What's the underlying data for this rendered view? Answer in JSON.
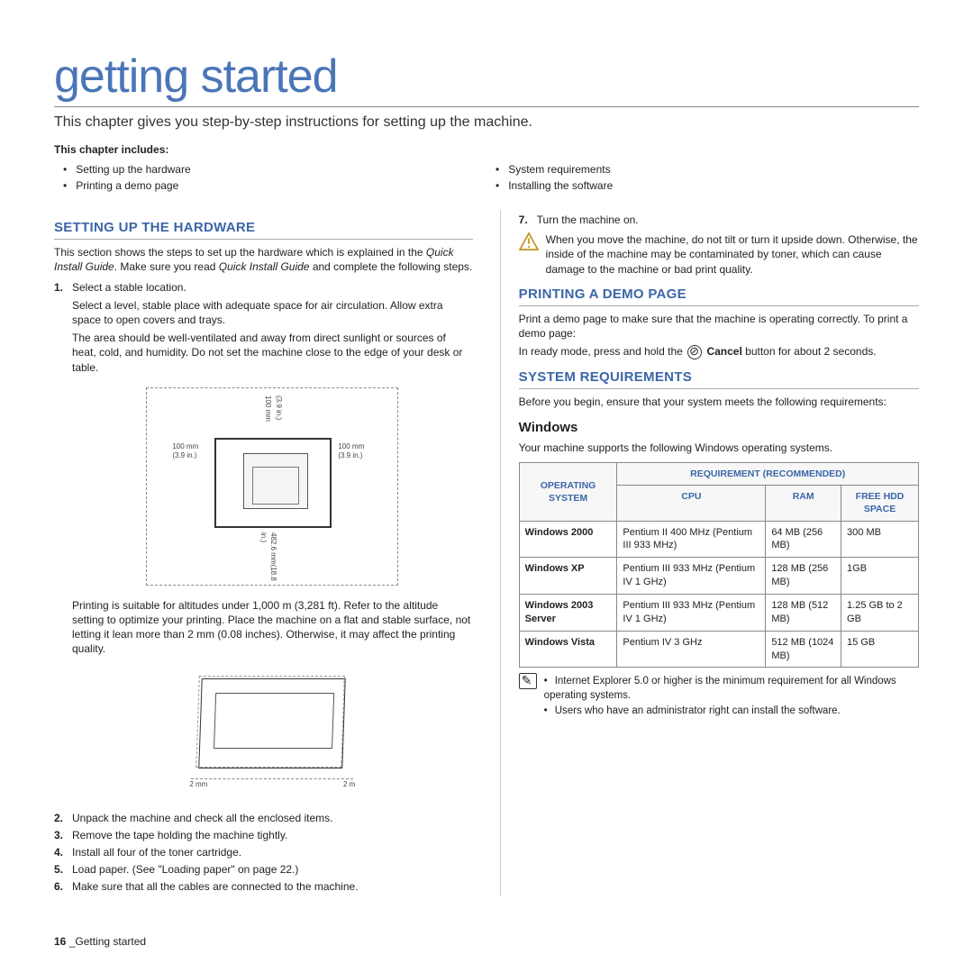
{
  "title": "getting started",
  "subtitle": "This chapter gives you step-by-step instructions for setting up the machine.",
  "includes_label": "This chapter includes:",
  "includes_left": [
    "Setting up the hardware",
    "Printing a demo page"
  ],
  "includes_right": [
    "System requirements",
    "Installing the software"
  ],
  "sec_hardware": {
    "heading": "SETTING UP THE HARDWARE",
    "intro_1": "This section shows the steps to set up the hardware which is explained in the ",
    "intro_em1": "Quick Install Guide",
    "intro_2": ". Make sure you read ",
    "intro_em2": "Quick Install Guide",
    "intro_3": " and complete the following steps.",
    "step1_head": "Select a stable location.",
    "step1_p1": "Select a level, stable place with adequate space for air circulation. Allow extra space to open covers and trays.",
    "step1_p2": "The area should be well-ventilated and away from direct sunlight or sources of heat, cold, and humidity. Do not set the machine close to the edge of your desk or table.",
    "fig1_dims": {
      "top": "100 mm",
      "top2": "(3.9 in.)",
      "left": "100 mm",
      "left2": "(3.9 in.)",
      "right": "100 mm",
      "right2": "(3.9 in.)",
      "bottom": "482.6 mm(18.8 in.)"
    },
    "alt_para": "Printing is suitable for altitudes under 1,000 m (3,281 ft). Refer to the altitude setting to optimize your printing. Place the machine on a flat and stable surface, not letting it lean more than 2 mm (0.08 inches). Otherwise, it may affect the printing quality.",
    "fig2_left": "2 mm",
    "fig2_right": "2 m",
    "steps": [
      {
        "n": "2.",
        "t": "Unpack the machine and check all the enclosed items."
      },
      {
        "n": "3.",
        "t": "Remove the tape holding the machine tightly."
      },
      {
        "n": "4.",
        "t": "Install all four of the toner cartridge."
      },
      {
        "n": "5.",
        "t": "Load paper. (See \"Loading paper\" on page 22.)"
      },
      {
        "n": "6.",
        "t": "Make sure that all the cables are connected to the machine."
      }
    ]
  },
  "right_col": {
    "step7": {
      "n": "7.",
      "t": "Turn the machine on."
    },
    "warn": "When you move the machine, do not tilt or turn it upside down. Otherwise, the inside of the machine may be contaminated by toner, which can cause damage to the machine or bad print quality."
  },
  "sec_demo": {
    "heading": "PRINTING A DEMO PAGE",
    "p1": "Print a demo page to make sure that the machine is operating correctly. To print a demo page:",
    "p2_a": "In ready mode, press and hold the ",
    "p2_b": " Cancel",
    "p2_c": " button for about 2 seconds."
  },
  "sec_sys": {
    "heading": "SYSTEM REQUIREMENTS",
    "intro": "Before you begin, ensure that your system meets the following requirements:",
    "sub": "Windows",
    "sub_p": "Your machine supports the following Windows operating systems.",
    "th_os": "OPERATING SYSTEM",
    "th_req": "REQUIREMENT (RECOMMENDED)",
    "th_cpu": "CPU",
    "th_ram": "RAM",
    "th_hdd": "FREE HDD SPACE",
    "rows": [
      {
        "os": "Windows 2000",
        "cpu": "Pentium II 400 MHz (Pentium III 933 MHz)",
        "ram": "64 MB (256 MB)",
        "hdd": "300 MB"
      },
      {
        "os": "Windows XP",
        "cpu": "Pentium III 933 MHz (Pentium IV 1 GHz)",
        "ram": "128 MB (256 MB)",
        "hdd": "1GB"
      },
      {
        "os": "Windows 2003 Server",
        "cpu": "Pentium III 933 MHz (Pentium IV 1 GHz)",
        "ram": "128 MB (512 MB)",
        "hdd": "1.25 GB to 2 GB"
      },
      {
        "os": "Windows Vista",
        "cpu": "Pentium IV 3 GHz",
        "ram": "512 MB (1024 MB)",
        "hdd": "15 GB"
      }
    ],
    "notes": [
      "Internet Explorer 5.0 or higher is the minimum requirement for all Windows operating systems.",
      "Users who have an administrator right can install the software."
    ]
  },
  "footer_num": "16",
  "footer_sep": " _",
  "footer_text": "Getting started"
}
